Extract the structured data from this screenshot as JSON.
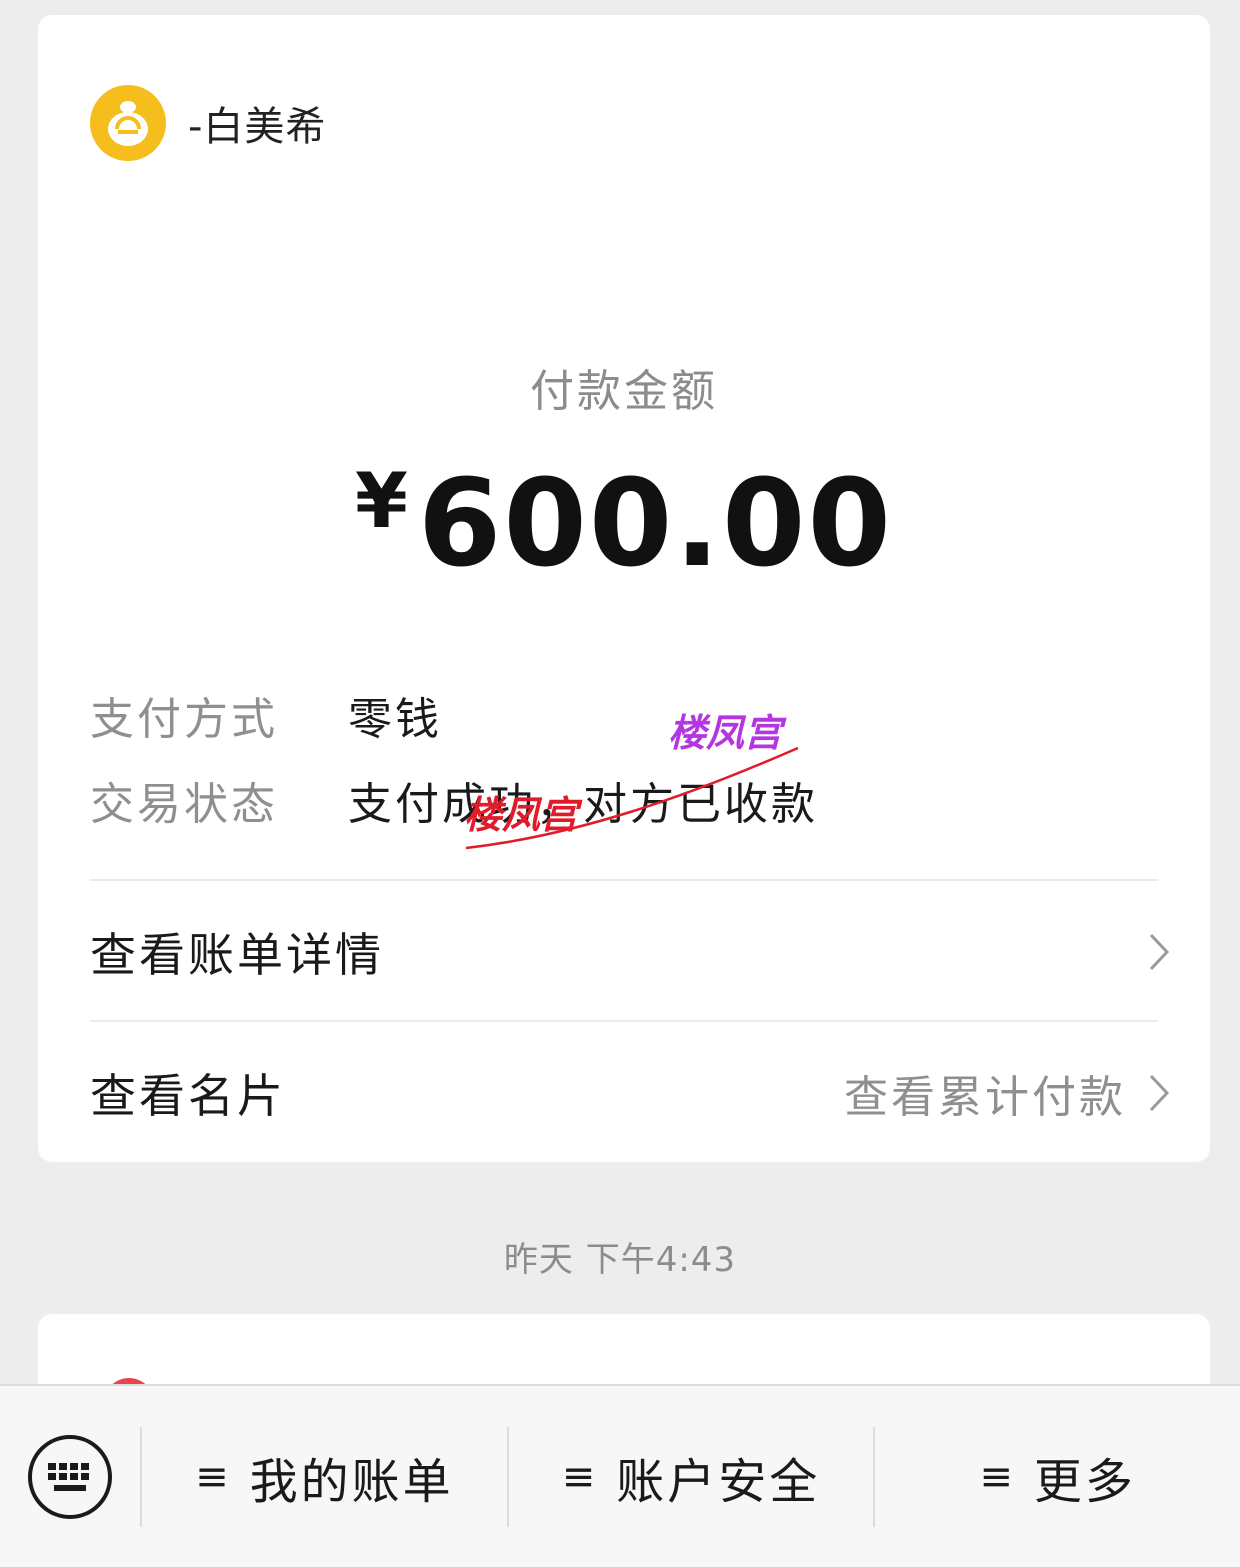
{
  "merchant": {
    "name": "-白美希",
    "avatar_icon": "wechat-pay-merchant-icon"
  },
  "payment": {
    "amount_label": "付款金额",
    "currency_symbol": "¥",
    "amount": "600.00"
  },
  "details": [
    {
      "key": "支付方式",
      "value": "零钱"
    },
    {
      "key": "交易状态",
      "value": "支付成功，对方已收款"
    }
  ],
  "links": {
    "bill_details": "查看账单详情",
    "view_card": "查看名片",
    "cumulative_payments": "查看累计付款"
  },
  "timestamp": "昨天 下午4:43",
  "bottom_menu": {
    "keyboard_icon": "keyboard-icon",
    "items": [
      "我的账单",
      "账户安全",
      "更多"
    ]
  },
  "watermark": {
    "text": "楼凤宫"
  },
  "colors": {
    "avatar": "#f5be1d",
    "watermark_purple": "#b535e0",
    "watermark_red": "#e01b2a"
  }
}
